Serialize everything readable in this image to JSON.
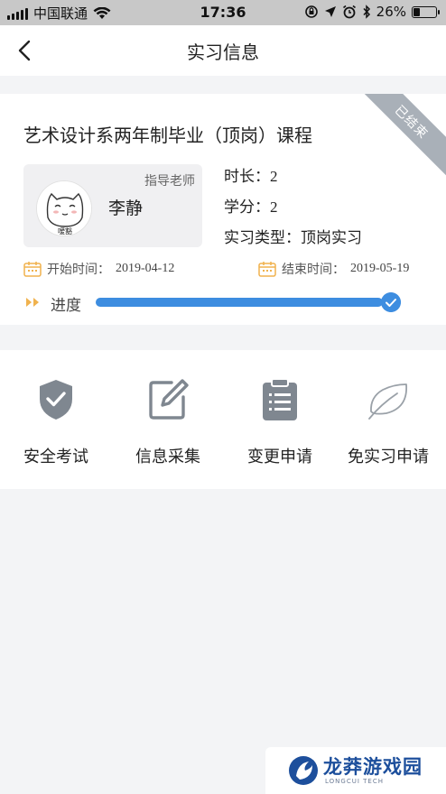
{
  "status_bar": {
    "carrier": "中国联通",
    "time": "17:36",
    "battery_percent": "26%",
    "battery_level": 0.26
  },
  "nav": {
    "title": "实习信息",
    "back_icon": "chevron-left-icon"
  },
  "course": {
    "title": "艺术设计系两年制毕业（顶岗）课程",
    "status_ribbon": "已结束",
    "teacher": {
      "role_label": "指导老师",
      "name": "李静",
      "avatar_caption": "嗳豁"
    },
    "info": {
      "duration_label": "时长：",
      "duration_value": "2",
      "credit_label": "学分：",
      "credit_value": "2",
      "type_label": "实习类型：",
      "type_value": "顶岗实习"
    },
    "start_label": "开始时间：",
    "start_date": "2019-04-12",
    "end_label": "结束时间：",
    "end_date": "2019-05-19",
    "progress_label": "进度",
    "progress": 1.0
  },
  "actions": [
    {
      "label": "安全考试",
      "icon": "shield-check-icon"
    },
    {
      "label": "信息采集",
      "icon": "edit-icon"
    },
    {
      "label": "变更申请",
      "icon": "clipboard-icon"
    },
    {
      "label": "免实习申请",
      "icon": "leaf-icon"
    }
  ],
  "watermark": {
    "title": "龙莽游戏园",
    "subtitle": "LONGCUI TECH"
  },
  "colors": {
    "accent": "#3d8de0",
    "icon_gray": "#7f8790",
    "ribbon": "#a9b0b8",
    "calendar": "#f0b24e"
  }
}
